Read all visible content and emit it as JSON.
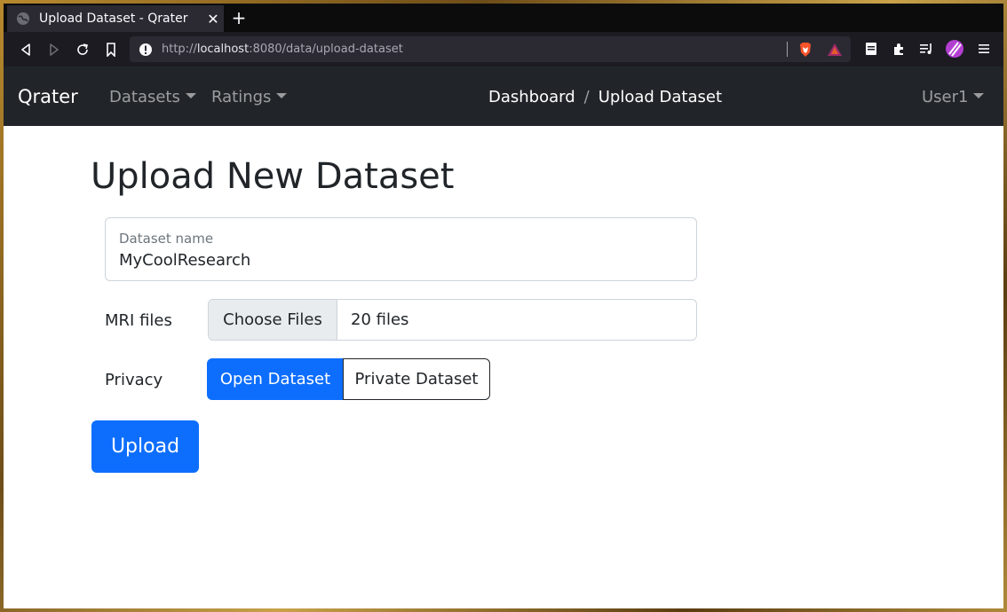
{
  "browser": {
    "tab_title": "Upload Dataset - Qrater",
    "url_prefix": "http://",
    "url_host": "localhost",
    "url_path": ":8080/data/upload-dataset"
  },
  "navbar": {
    "brand": "Qrater",
    "datasets": "Datasets",
    "ratings": "Ratings",
    "breadcrumb_dashboard": "Dashboard",
    "breadcrumb_separator": "/",
    "breadcrumb_current": "Upload Dataset",
    "user": "User1"
  },
  "form": {
    "title": "Upload New Dataset",
    "dataset_name_label": "Dataset name",
    "dataset_name_value": "MyCoolResearch",
    "mri_label": "MRI files",
    "choose_files": "Choose Files",
    "files_selected": "20 files",
    "privacy_label": "Privacy",
    "open_dataset": "Open Dataset",
    "private_dataset": "Private Dataset",
    "upload": "Upload"
  },
  "colors": {
    "primary": "#0d6efd",
    "navbar_bg": "#212529"
  }
}
